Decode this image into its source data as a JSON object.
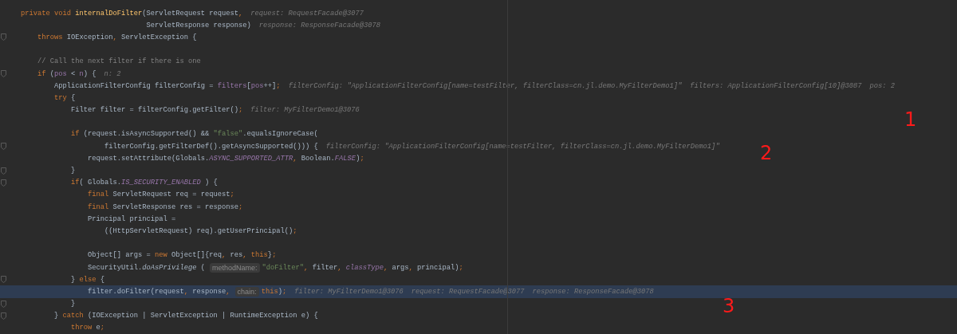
{
  "editor": {
    "lines": [
      {
        "fold": false,
        "current": false,
        "segments": [
          {
            "kind": "code",
            "tokens": [
              {
                "kind": "keyword",
                "text": "private void "
              },
              {
                "kind": "method",
                "text": "internalDoFilter"
              },
              {
                "kind": "plain",
                "text": "(ServletRequest request"
              },
              {
                "kind": "keyword",
                "text": ","
              }
            ]
          },
          {
            "kind": "debug",
            "text": "request: RequestFacade@3077"
          }
        ]
      },
      {
        "fold": false,
        "current": false,
        "segments": [
          {
            "kind": "code",
            "tokens": [
              {
                "kind": "plain",
                "text": "                              ServletResponse response)"
              }
            ]
          },
          {
            "kind": "debug",
            "text": "response: ResponseFacade@3078"
          }
        ]
      },
      {
        "fold": true,
        "current": false,
        "segments": [
          {
            "kind": "code",
            "tokens": [
              {
                "kind": "keyword",
                "text": "    throws "
              },
              {
                "kind": "plain",
                "text": "IOException"
              },
              {
                "kind": "keyword",
                "text": ", "
              },
              {
                "kind": "plain",
                "text": "ServletException {"
              }
            ]
          }
        ]
      },
      {
        "fold": false,
        "current": false
      },
      {
        "fold": false,
        "current": false,
        "segments": [
          {
            "kind": "code",
            "tokens": [
              {
                "kind": "comment",
                "text": "    // Call the next filter if there is one"
              }
            ]
          }
        ]
      },
      {
        "fold": true,
        "current": false,
        "segments": [
          {
            "kind": "code",
            "tokens": [
              {
                "kind": "keyword",
                "text": "    if "
              },
              {
                "kind": "plain",
                "text": "("
              },
              {
                "kind": "variable",
                "text": "pos "
              },
              {
                "kind": "plain",
                "text": "< "
              },
              {
                "kind": "variable",
                "text": "n"
              },
              {
                "kind": "plain",
                "text": ") {"
              }
            ]
          },
          {
            "kind": "debug",
            "text": "n: 2"
          }
        ]
      },
      {
        "fold": false,
        "current": false,
        "segments": [
          {
            "kind": "code",
            "tokens": [
              {
                "kind": "plain",
                "text": "        ApplicationFilterConfig filterConfig = "
              },
              {
                "kind": "variable",
                "text": "filters"
              },
              {
                "kind": "plain",
                "text": "["
              },
              {
                "kind": "variable",
                "text": "pos"
              },
              {
                "kind": "plain",
                "text": "++]"
              },
              {
                "kind": "keyword",
                "text": ";"
              }
            ]
          },
          {
            "kind": "debug",
            "text": "filterConfig: \"ApplicationFilterConfig[name=testFilter, filterClass=cn.jl.demo.MyFilterDemo1]\""
          },
          {
            "kind": "debug",
            "text": "filters: ApplicationFilterConfig[10]@3087"
          },
          {
            "kind": "debug",
            "text": "pos: 2"
          }
        ]
      },
      {
        "fold": false,
        "current": false,
        "segments": [
          {
            "kind": "code",
            "tokens": [
              {
                "kind": "keyword",
                "text": "        try "
              },
              {
                "kind": "plain",
                "text": "{"
              }
            ]
          }
        ]
      },
      {
        "fold": false,
        "current": false,
        "segments": [
          {
            "kind": "code",
            "tokens": [
              {
                "kind": "plain",
                "text": "            Filter filter = filterConfig.getFilter()"
              },
              {
                "kind": "keyword",
                "text": ";"
              }
            ]
          },
          {
            "kind": "debug",
            "text": "filter: MyFilterDemo1@3076"
          }
        ]
      },
      {
        "fold": false,
        "current": false
      },
      {
        "fold": false,
        "current": false,
        "segments": [
          {
            "kind": "code",
            "tokens": [
              {
                "kind": "keyword",
                "text": "            if "
              },
              {
                "kind": "plain",
                "text": "(request.isAsyncSupported() && "
              },
              {
                "kind": "string",
                "text": "\"false\""
              },
              {
                "kind": "plain",
                "text": ".equalsIgnoreCase("
              }
            ]
          }
        ]
      },
      {
        "fold": true,
        "current": false,
        "segments": [
          {
            "kind": "code",
            "tokens": [
              {
                "kind": "plain",
                "text": "                    filterConfig.getFilterDef().getAsyncSupported())) {"
              }
            ]
          },
          {
            "kind": "debug",
            "text": "filterConfig: \"ApplicationFilterConfig[name=testFilter, filterClass=cn.jl.demo.MyFilterDemo1]\""
          }
        ]
      },
      {
        "fold": false,
        "current": false,
        "segments": [
          {
            "kind": "code",
            "tokens": [
              {
                "kind": "plain",
                "text": "                request.setAttribute(Globals."
              },
              {
                "kind": "field",
                "text": "ASYNC_SUPPORTED_ATTR"
              },
              {
                "kind": "keyword",
                "text": ", "
              },
              {
                "kind": "plain",
                "text": "Boolean."
              },
              {
                "kind": "field",
                "text": "FALSE"
              },
              {
                "kind": "plain",
                "text": ")"
              },
              {
                "kind": "keyword",
                "text": ";"
              }
            ]
          }
        ]
      },
      {
        "fold": true,
        "current": false,
        "segments": [
          {
            "kind": "code",
            "tokens": [
              {
                "kind": "plain",
                "text": "            }"
              }
            ]
          }
        ]
      },
      {
        "fold": true,
        "current": false,
        "segments": [
          {
            "kind": "code",
            "tokens": [
              {
                "kind": "keyword",
                "text": "            if"
              },
              {
                "kind": "plain",
                "text": "( Globals."
              },
              {
                "kind": "field",
                "text": "IS_SECURITY_ENABLED"
              },
              {
                "kind": "plain",
                "text": " ) {"
              }
            ]
          }
        ]
      },
      {
        "fold": false,
        "current": false,
        "segments": [
          {
            "kind": "code",
            "tokens": [
              {
                "kind": "keyword",
                "text": "                final "
              },
              {
                "kind": "plain",
                "text": "ServletRequest req = request"
              },
              {
                "kind": "keyword",
                "text": ";"
              }
            ]
          }
        ]
      },
      {
        "fold": false,
        "current": false,
        "segments": [
          {
            "kind": "code",
            "tokens": [
              {
                "kind": "keyword",
                "text": "                final "
              },
              {
                "kind": "plain",
                "text": "ServletResponse res = response"
              },
              {
                "kind": "keyword",
                "text": ";"
              }
            ]
          }
        ]
      },
      {
        "fold": false,
        "current": false,
        "segments": [
          {
            "kind": "code",
            "tokens": [
              {
                "kind": "plain",
                "text": "                Principal principal ="
              }
            ]
          }
        ]
      },
      {
        "fold": false,
        "current": false,
        "segments": [
          {
            "kind": "code",
            "tokens": [
              {
                "kind": "plain",
                "text": "                    ((HttpServletRequest) req).getUserPrincipal()"
              },
              {
                "kind": "keyword",
                "text": ";"
              }
            ]
          }
        ]
      },
      {
        "fold": false,
        "current": false
      },
      {
        "fold": false,
        "current": false,
        "segments": [
          {
            "kind": "code",
            "tokens": [
              {
                "kind": "plain",
                "text": "                Object[] args = "
              },
              {
                "kind": "keyword",
                "text": "new "
              },
              {
                "kind": "plain",
                "text": "Object[]{req"
              },
              {
                "kind": "keyword",
                "text": ", "
              },
              {
                "kind": "plain",
                "text": "res"
              },
              {
                "kind": "keyword",
                "text": ", this"
              },
              {
                "kind": "plain",
                "text": "}"
              },
              {
                "kind": "keyword",
                "text": ";"
              }
            ]
          }
        ]
      },
      {
        "fold": false,
        "current": false,
        "segments": [
          {
            "kind": "code",
            "tokens": [
              {
                "kind": "plain",
                "text": "                SecurityUtil."
              },
              {
                "kind": "italic",
                "text": "doAsPrivilege"
              },
              {
                "kind": "plain",
                "text": " ("
              }
            ]
          },
          {
            "kind": "param",
            "text": "methodName:"
          },
          {
            "kind": "code",
            "tokens": [
              {
                "kind": "string",
                "text": "\"doFilter\""
              },
              {
                "kind": "keyword",
                "text": ", "
              },
              {
                "kind": "plain",
                "text": "filter"
              },
              {
                "kind": "keyword",
                "text": ", "
              },
              {
                "kind": "field",
                "text": "classType"
              },
              {
                "kind": "keyword",
                "text": ", "
              },
              {
                "kind": "plain",
                "text": "args"
              },
              {
                "kind": "keyword",
                "text": ", "
              },
              {
                "kind": "plain",
                "text": "principal)"
              },
              {
                "kind": "keyword",
                "text": ";"
              }
            ]
          }
        ]
      },
      {
        "fold": true,
        "current": false,
        "segments": [
          {
            "kind": "code",
            "tokens": [
              {
                "kind": "plain",
                "text": "            } "
              },
              {
                "kind": "keyword",
                "text": "else "
              },
              {
                "kind": "plain",
                "text": "{"
              }
            ]
          }
        ]
      },
      {
        "fold": false,
        "current": true,
        "segments": [
          {
            "kind": "code",
            "tokens": [
              {
                "kind": "plain",
                "text": "                filter.doFilter(request"
              },
              {
                "kind": "keyword",
                "text": ", "
              },
              {
                "kind": "plain",
                "text": "response"
              },
              {
                "kind": "keyword",
                "text": ","
              }
            ]
          },
          {
            "kind": "param",
            "text": "chain:"
          },
          {
            "kind": "code",
            "tokens": [
              {
                "kind": "keyword",
                "text": "this"
              },
              {
                "kind": "plain",
                "text": ")"
              },
              {
                "kind": "keyword",
                "text": ";"
              }
            ]
          },
          {
            "kind": "debug",
            "text": "filter: MyFilterDemo1@3076"
          },
          {
            "kind": "debug",
            "text": "request: RequestFacade@3077"
          },
          {
            "kind": "debug",
            "text": "response: ResponseFacade@3078"
          }
        ]
      },
      {
        "fold": true,
        "current": false,
        "segments": [
          {
            "kind": "code",
            "tokens": [
              {
                "kind": "plain",
                "text": "            }"
              }
            ]
          }
        ]
      },
      {
        "fold": true,
        "current": false,
        "segments": [
          {
            "kind": "code",
            "tokens": [
              {
                "kind": "plain",
                "text": "        } "
              },
              {
                "kind": "keyword",
                "text": "catch "
              },
              {
                "kind": "plain",
                "text": "(IOException | ServletException | RuntimeException e) {"
              }
            ]
          }
        ]
      },
      {
        "fold": false,
        "current": false,
        "segments": [
          {
            "kind": "code",
            "tokens": [
              {
                "kind": "keyword",
                "text": "            throw "
              },
              {
                "kind": "plain",
                "text": "e"
              },
              {
                "kind": "keyword",
                "text": ";"
              }
            ]
          }
        ]
      }
    ]
  },
  "annotations": [
    {
      "text": "1"
    },
    {
      "text": "2"
    },
    {
      "text": "3"
    }
  ]
}
